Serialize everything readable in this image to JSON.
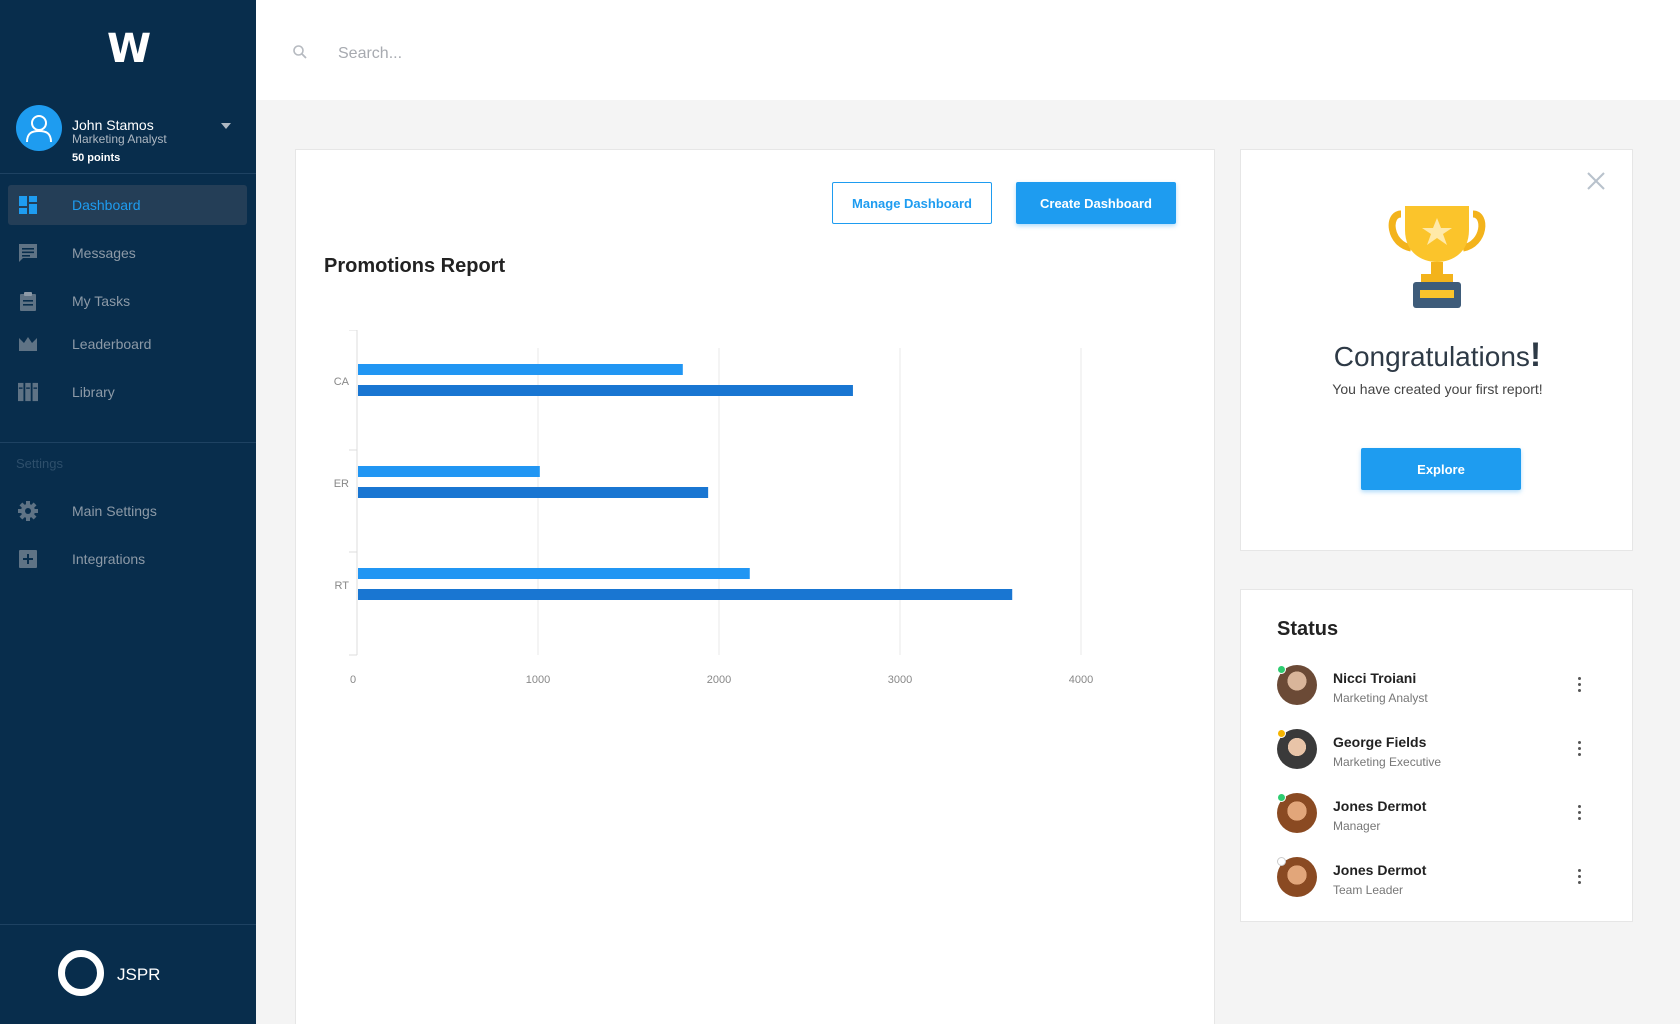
{
  "sidebar": {
    "logo": "W",
    "profile": {
      "name": "John Stamos",
      "role": "Marketing Analyst",
      "points": "50 points"
    },
    "nav": [
      {
        "label": "Dashboard",
        "icon": "dashboard-icon",
        "active": true
      },
      {
        "label": "Messages",
        "icon": "message-icon"
      },
      {
        "label": "My Tasks",
        "icon": "clipboard-icon"
      },
      {
        "label": "Leaderboard",
        "icon": "crown-icon"
      },
      {
        "label": "Library",
        "icon": "library-icon"
      }
    ],
    "settings_heading": "Settings",
    "settings_nav": [
      {
        "label": "Main Settings",
        "icon": "gear-icon"
      },
      {
        "label": "Integrations",
        "icon": "plus-box-icon"
      }
    ],
    "brand": "JSPR"
  },
  "search": {
    "placeholder": "Search..."
  },
  "main": {
    "manage_label": "Manage Dashboard",
    "create_label": "Create Dashboard",
    "report_title": "Promotions Report"
  },
  "chart_data": {
    "type": "bar",
    "orientation": "horizontal",
    "categories": [
      "CA",
      "ER",
      "RT"
    ],
    "series": [
      {
        "values": [
          1800,
          1010,
          2170
        ]
      },
      {
        "values": [
          2740,
          1940,
          3620
        ]
      }
    ],
    "xlim": [
      0,
      4000
    ],
    "xticks": [
      "0",
      "1000",
      "2000",
      "3000",
      "4000"
    ],
    "grid": true,
    "colors": [
      "#2196f3",
      "#1976d2"
    ]
  },
  "congrats": {
    "title": "Congratulations",
    "exclamation": "!",
    "subtitle": "You have created your first report!",
    "explore_label": "Explore"
  },
  "status": {
    "title": "Status",
    "people": [
      {
        "name": "Nicci Troiani",
        "role": "Marketing Analyst",
        "dot": "#2ecc71"
      },
      {
        "name": "George Fields",
        "role": "Marketing Executive",
        "dot": "#f5b400"
      },
      {
        "name": "Jones Dermot",
        "role": "Manager",
        "dot": "#2ecc71"
      },
      {
        "name": "Jones Dermot",
        "role": "Team Leader",
        "dot": "#ffffff"
      }
    ]
  },
  "colors": {
    "sidebar": "#082d4c",
    "accent": "#1e9cf0"
  }
}
